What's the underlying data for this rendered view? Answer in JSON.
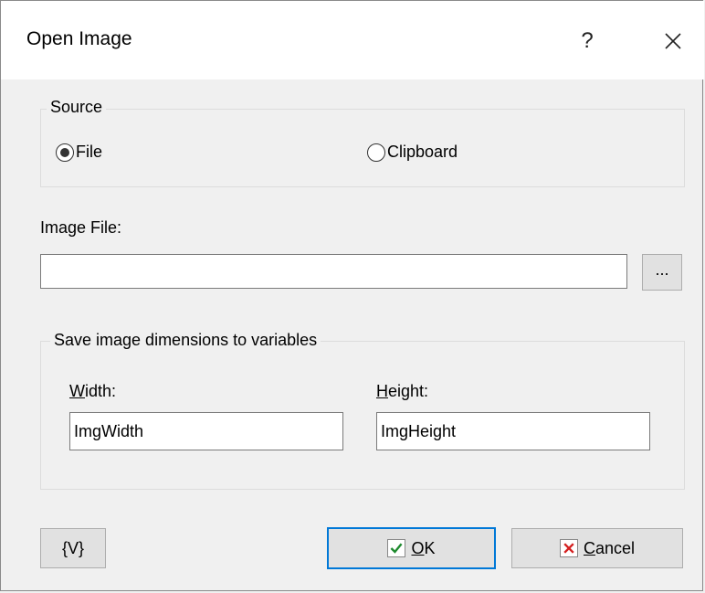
{
  "window": {
    "title": "Open Image",
    "help_label": "?"
  },
  "source_group": {
    "legend": "Source",
    "options": [
      {
        "label": "File",
        "selected": true
      },
      {
        "label": "Clipboard",
        "selected": false
      }
    ]
  },
  "image_file": {
    "label": "Image File:",
    "value": "",
    "browse_label": "..."
  },
  "dimensions_group": {
    "legend": "Save image dimensions to variables",
    "width_label_mnemonic": "W",
    "width_label_rest": "idth:",
    "width_value": "ImgWidth",
    "height_label_mnemonic": "H",
    "height_label_rest": "eight:",
    "height_value": "ImgHeight"
  },
  "footer": {
    "variables_label": "{V}",
    "ok_mnemonic": "O",
    "ok_rest": "K",
    "cancel_mnemonic": "C",
    "cancel_rest": "ancel"
  },
  "colors": {
    "accent": "#0078d7",
    "ok_check": "#1e8a2e",
    "cancel_x": "#d42020"
  },
  "icons": [
    "question-icon",
    "close-icon",
    "check-icon",
    "cancel-x-icon"
  ]
}
